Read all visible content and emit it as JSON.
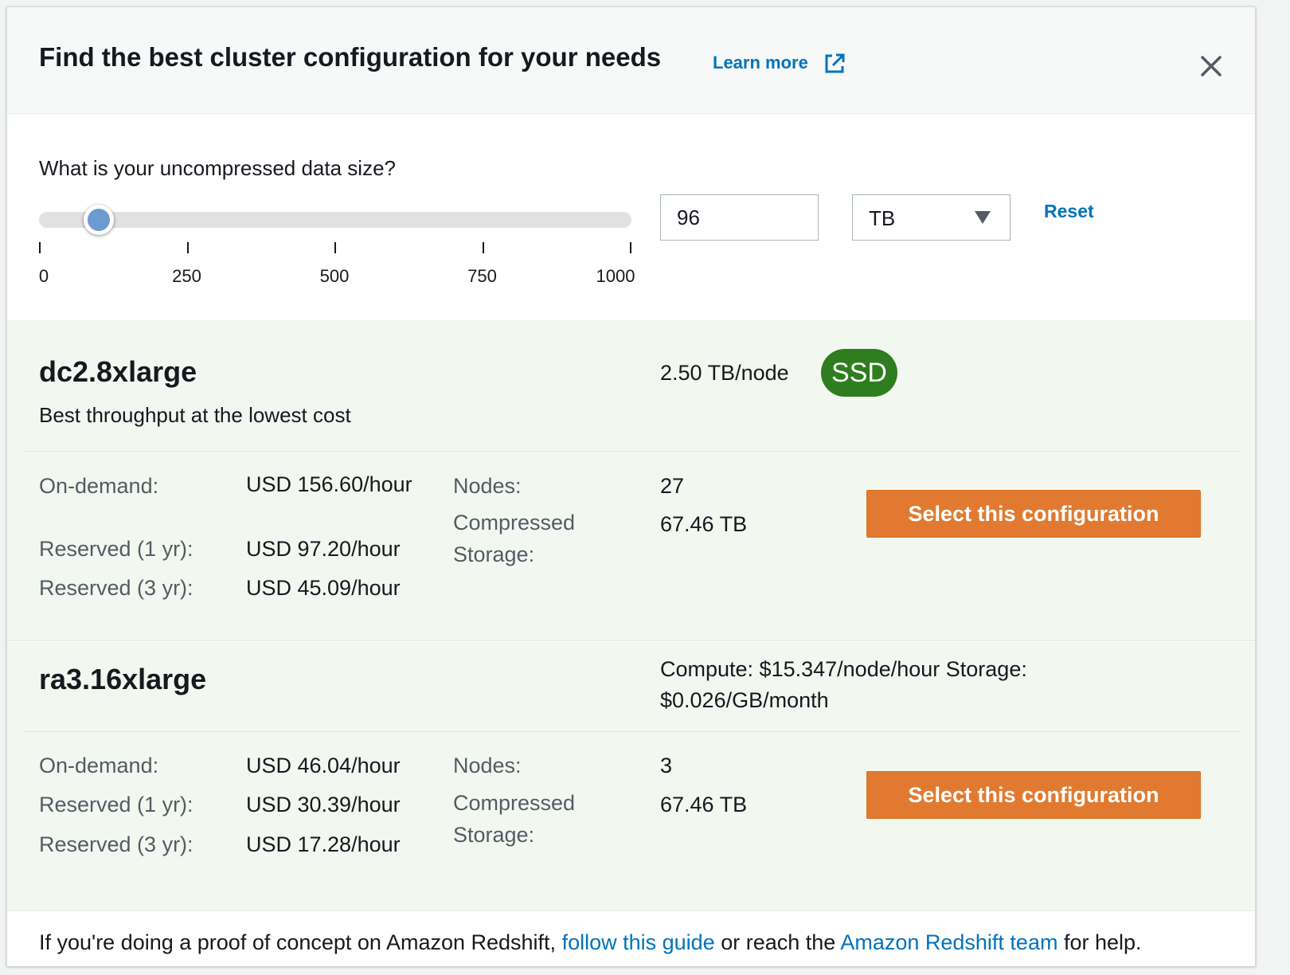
{
  "header": {
    "title": "Find the best cluster configuration for your needs",
    "learn_more": "Learn more"
  },
  "sizer": {
    "question": "What is your uncompressed data size?",
    "slider": {
      "min": 0,
      "max": 1000,
      "value": 96
    },
    "ticks": [
      "0",
      "250",
      "500",
      "750",
      "1000"
    ],
    "input_value": "96",
    "unit": "TB",
    "reset_label": "Reset"
  },
  "configs": [
    {
      "name": "dc2.8xlarge",
      "subtitle": "Best throughput at the lowest cost",
      "per_node": "2.50 TB/node",
      "badge": "SSD",
      "on_demand_label": "On-demand:",
      "on_demand": "USD 156.60/hour",
      "reserved_1yr_label": "Reserved (1 yr):",
      "reserved_1yr": "USD 97.20/hour",
      "reserved_3yr_label": "Reserved (3 yr):",
      "reserved_3yr": "USD 45.09/hour",
      "nodes_label": "Nodes:",
      "nodes": "27",
      "storage_label": "Compressed Storage:",
      "storage": "67.46 TB",
      "button": "Select this configuration"
    },
    {
      "name": "ra3.16xlarge",
      "pricing": "Compute: $15.347/node/hour Storage: $0.026/GB/month",
      "on_demand_label": "On-demand:",
      "on_demand": "USD 46.04/hour",
      "reserved_1yr_label": "Reserved (1 yr):",
      "reserved_1yr": "USD 30.39/hour",
      "reserved_3yr_label": "Reserved (3 yr):",
      "reserved_3yr": "USD 17.28/hour",
      "nodes_label": "Nodes:",
      "nodes": "3",
      "storage_label": "Compressed Storage:",
      "storage": "67.46 TB",
      "button": "Select this configuration"
    }
  ],
  "footer": {
    "prefix": "If you're doing a proof of concept on Amazon Redshift,",
    "link1": "follow this guide",
    "middle": "or reach the",
    "link2": "Amazon Redshift team",
    "suffix": "for help."
  },
  "colors": {
    "link": "#0073bb",
    "primary_button": "#e17a30",
    "ssd_badge": "#2e7d1e",
    "config_bg": "#f2f8f0"
  }
}
